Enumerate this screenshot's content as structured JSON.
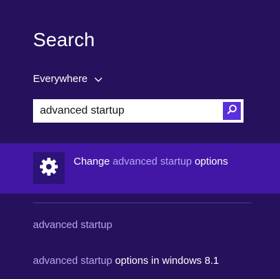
{
  "search_pane": {
    "title": "Search",
    "scope": "Everywhere",
    "query": "advanced startup"
  },
  "results": {
    "top": {
      "part1": "Change ",
      "part2": "advanced startup",
      "part3": " options"
    },
    "suggestions": [
      {
        "match": "advanced startup",
        "rest": ""
      },
      {
        "match": "advanced startup",
        "rest": " options in windows 8.1"
      }
    ]
  },
  "colors": {
    "background": "#26125c",
    "selected_result": "#4217a6",
    "search_button": "#5a2fdc",
    "muted_text": "#b9a6f0"
  },
  "icons": {
    "scope": "chevron-down-icon",
    "search": "search-icon",
    "result": "gear-icon"
  }
}
